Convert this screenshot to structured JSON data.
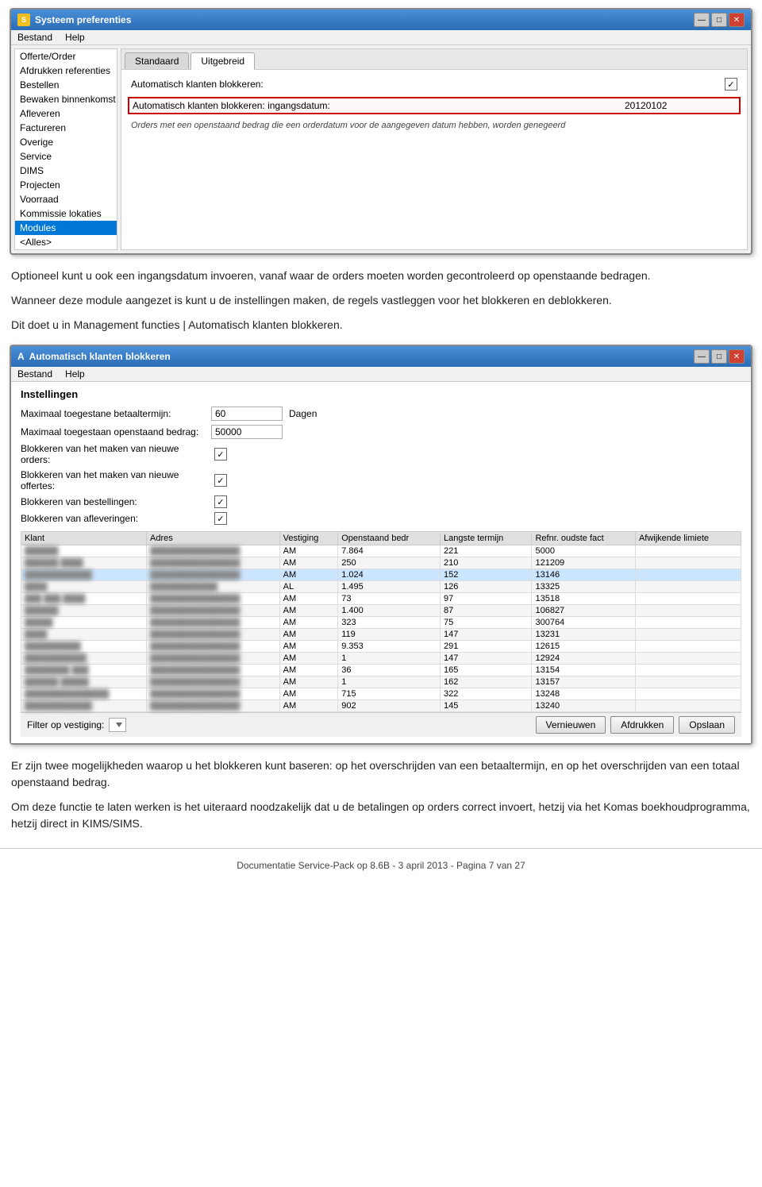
{
  "window1": {
    "title": "Systeem preferenties",
    "menubar": [
      "Bestand",
      "Help"
    ],
    "sidebar": {
      "items": [
        {
          "label": "Offerte/Order",
          "selected": false
        },
        {
          "label": "Afdrukken referenties",
          "selected": false
        },
        {
          "label": "Bestellen",
          "selected": false
        },
        {
          "label": "Bewaken binnenkomst",
          "selected": false
        },
        {
          "label": "Afleveren",
          "selected": false
        },
        {
          "label": "Factureren",
          "selected": false
        },
        {
          "label": "Overige",
          "selected": false
        },
        {
          "label": "Service",
          "selected": false
        },
        {
          "label": "DIMS",
          "selected": false
        },
        {
          "label": "Projecten",
          "selected": false
        },
        {
          "label": "Voorraad",
          "selected": false
        },
        {
          "label": "Kommissie lokaties",
          "selected": false
        },
        {
          "label": "Modules",
          "selected": true
        },
        {
          "label": "<Alles>",
          "selected": false
        }
      ]
    },
    "tabs": [
      {
        "label": "Standaard",
        "active": false
      },
      {
        "label": "Uitgebreid",
        "active": true
      }
    ],
    "form": {
      "row1_label": "Automatisch klanten blokkeren:",
      "row1_checked": true,
      "row2_label": "Automatisch klanten blokkeren: ingangsdatum:",
      "row2_value": "20120102",
      "help_text": "Orders met een openstaand bedrag die een orderdatum voor de aangegeven datum hebben, worden genegeerd"
    }
  },
  "body_text": {
    "para1": "Optioneel kunt u ook een ingangsdatum invoeren, vanaf waar de orders moeten worden gecontroleerd op openstaande bedragen.",
    "para2": "Wanneer deze module aangezet is kunt u de instellingen maken, de regels vastleggen voor het blokkeren en deblokkeren.",
    "para3": "Dit doet u in Management functies | Automatisch klanten blokkeren."
  },
  "window2": {
    "title": "Automatisch klanten blokkeren",
    "menubar": [
      "Bestand",
      "Help"
    ],
    "instellingen_label": "Instellingen",
    "settings": [
      {
        "label": "Maximaal toegestane betaaltermijn:",
        "value": "60",
        "unit": "Dagen",
        "type": "input"
      },
      {
        "label": "Maximaal toegestaan openstaand bedrag:",
        "value": "50000",
        "unit": "",
        "type": "input"
      },
      {
        "label": "Blokkeren van het maken van nieuwe orders:",
        "checked": true,
        "type": "check"
      },
      {
        "label": "Blokkeren van het maken van nieuwe offertes:",
        "checked": true,
        "type": "check"
      },
      {
        "label": "Blokkeren van bestellingen:",
        "checked": true,
        "type": "check"
      },
      {
        "label": "Blokkeren van afleveringen:",
        "checked": true,
        "type": "check"
      }
    ],
    "table": {
      "columns": [
        "Klant",
        "Adres",
        "Vestiging",
        "Openstaand bedr",
        "Langste termijn",
        "Refnr. oudste fact",
        "Afwijkende limiete"
      ],
      "rows": [
        {
          "klant": "██████",
          "adres": "████████████████",
          "vestiging": "AM",
          "openstaand": "7.864",
          "langste": "221",
          "refnr": "5000",
          "afwijkend": "",
          "selected": false
        },
        {
          "klant": "██████ ████",
          "adres": "████████████████",
          "vestiging": "AM",
          "openstaand": "250",
          "langste": "210",
          "refnr": "121209",
          "afwijkend": "",
          "selected": false
        },
        {
          "klant": "████████████",
          "adres": "████████████████",
          "vestiging": "AM",
          "openstaand": "1.024",
          "langste": "152",
          "refnr": "13146",
          "afwijkend": "",
          "selected": true
        },
        {
          "klant": "████",
          "adres": "████████████",
          "vestiging": "AL",
          "openstaand": "1.495",
          "langste": "126",
          "refnr": "13325",
          "afwijkend": "",
          "selected": false
        },
        {
          "klant": "███ ███ ████",
          "adres": "████████████████",
          "vestiging": "AM",
          "openstaand": "73",
          "langste": "97",
          "refnr": "13518",
          "afwijkend": "",
          "selected": false
        },
        {
          "klant": "██████",
          "adres": "████████████████",
          "vestiging": "AM",
          "openstaand": "1.400",
          "langste": "87",
          "refnr": "106827",
          "afwijkend": "",
          "selected": false
        },
        {
          "klant": "█████",
          "adres": "████████████████",
          "vestiging": "AM",
          "openstaand": "323",
          "langste": "75",
          "refnr": "300764",
          "afwijkend": "",
          "selected": false
        },
        {
          "klant": "████",
          "adres": "████████████████",
          "vestiging": "AM",
          "openstaand": "119",
          "langste": "147",
          "refnr": "13231",
          "afwijkend": "",
          "selected": false
        },
        {
          "klant": "██████████",
          "adres": "████████████████",
          "vestiging": "AM",
          "openstaand": "9.353",
          "langste": "291",
          "refnr": "12615",
          "afwijkend": "",
          "selected": false
        },
        {
          "klant": "███████████",
          "adres": "████████████████",
          "vestiging": "AM",
          "openstaand": "1",
          "langste": "147",
          "refnr": "12924",
          "afwijkend": "",
          "selected": false
        },
        {
          "klant": "████████ ███",
          "adres": "████████████████",
          "vestiging": "AM",
          "openstaand": "36",
          "langste": "165",
          "refnr": "13154",
          "afwijkend": "",
          "selected": false
        },
        {
          "klant": "██████ █████",
          "adres": "████████████████",
          "vestiging": "AM",
          "openstaand": "1",
          "langste": "162",
          "refnr": "13157",
          "afwijkend": "",
          "selected": false
        },
        {
          "klant": "███████████████",
          "adres": "████████████████",
          "vestiging": "AM",
          "openstaand": "715",
          "langste": "322",
          "refnr": "13248",
          "afwijkend": "",
          "selected": false
        },
        {
          "klant": "████████████",
          "adres": "████████████████",
          "vestiging": "AM",
          "openstaand": "902",
          "langste": "145",
          "refnr": "13240",
          "afwijkend": "",
          "selected": false
        }
      ]
    },
    "filter_label": "Filter op vestiging:",
    "buttons": {
      "refresh": "Vernieuwen",
      "print": "Afdrukken",
      "save": "Opslaan"
    }
  },
  "body_text2": {
    "para1": "Er zijn twee mogelijkheden waarop u het blokkeren kunt baseren: op het overschrijden van een betaaltermijn, en op het overschrijden van een totaal openstaand bedrag.",
    "para2": "Om deze functie te laten werken is het uiteraard noodzakelijk dat u de betalingen op orders correct invoert, hetzij via het Komas boekhoudprogramma, hetzij direct in KIMS/SIMS."
  },
  "footer": {
    "text": "Documentatie Service-Pack op 8.6B - 3 april 2013 - Pagina 7 van 27"
  }
}
